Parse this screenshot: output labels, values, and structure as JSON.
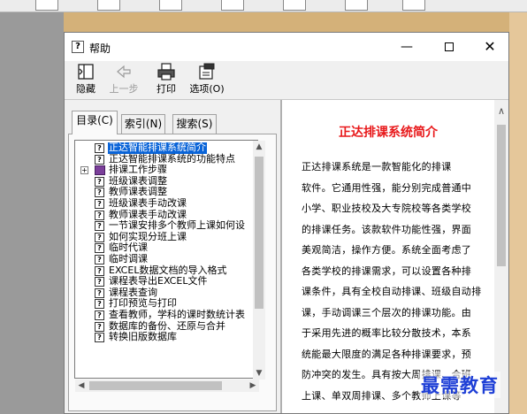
{
  "window": {
    "title": "帮助",
    "help_icon": "?",
    "controls": {
      "minimize": "—",
      "close": "✕"
    }
  },
  "toolbar": {
    "hide": "隐藏",
    "back": "上一步",
    "print": "打印",
    "options": "选项(O)"
  },
  "tabs": {
    "contents": "目录(C)",
    "index": "索引(N)",
    "search": "搜索(S)"
  },
  "tree": {
    "items": [
      {
        "label": "正达智能排课系统简介",
        "icon": "help-page-icon",
        "selected": true
      },
      {
        "label": "正达智能排课系统的功能特点",
        "icon": "help-page-icon"
      },
      {
        "label": "排课工作步骤",
        "icon": "book-icon",
        "expand": "+"
      },
      {
        "label": "班级课表调整",
        "icon": "help-page-icon"
      },
      {
        "label": "教师课表调整",
        "icon": "help-page-icon"
      },
      {
        "label": "班级课表手动改课",
        "icon": "help-page-icon"
      },
      {
        "label": "教师课表手动改课",
        "icon": "help-page-icon"
      },
      {
        "label": "一节课安排多个教师上课如何设",
        "icon": "help-page-icon"
      },
      {
        "label": "如何实现分班上课",
        "icon": "help-page-icon"
      },
      {
        "label": "临时代课",
        "icon": "help-page-icon"
      },
      {
        "label": "临时调课",
        "icon": "help-page-icon"
      },
      {
        "label": "EXCEL数据文档的导入格式",
        "icon": "help-page-icon"
      },
      {
        "label": "课程表导出EXCEL文件",
        "icon": "help-page-icon"
      },
      {
        "label": "课程表查询",
        "icon": "help-page-icon"
      },
      {
        "label": "打印预览与打印",
        "icon": "help-page-icon"
      },
      {
        "label": "查看教师，学科的课时数统计表",
        "icon": "help-page-icon"
      },
      {
        "label": "数据库的备份、还原与合并",
        "icon": "help-page-icon"
      },
      {
        "label": "转换旧版数据库",
        "icon": "help-page-icon"
      }
    ]
  },
  "document": {
    "title": "正达排课系统简介",
    "lines": [
      "    正达排课系统是一款智能化的排课",
      "软件。它通用性强，能分别完成普通中",
      "小学、职业技校及大专院校等各类学校",
      "的排课任务。该款软件功能性强，界面",
      "美观简洁，操作方便。系统全面考虑了",
      "各类学校的排课需求，可以设置各种排",
      "课条件，具有全校自动排课、班级自动排",
      "课，手动调课三个层次的排课功能。由",
      "于采用先进的概率比较分散技术，本系",
      "统能最大限度的满足各种排课要求，预",
      "防冲突的发生。具有按大周排课、合班",
      "上课、单双周排课、多个教师上课等"
    ]
  },
  "watermark": "最需教育",
  "colors": {
    "doc_title": "#e8181a",
    "selection": "#0a64d8",
    "watermark": "#1e3fd6"
  }
}
